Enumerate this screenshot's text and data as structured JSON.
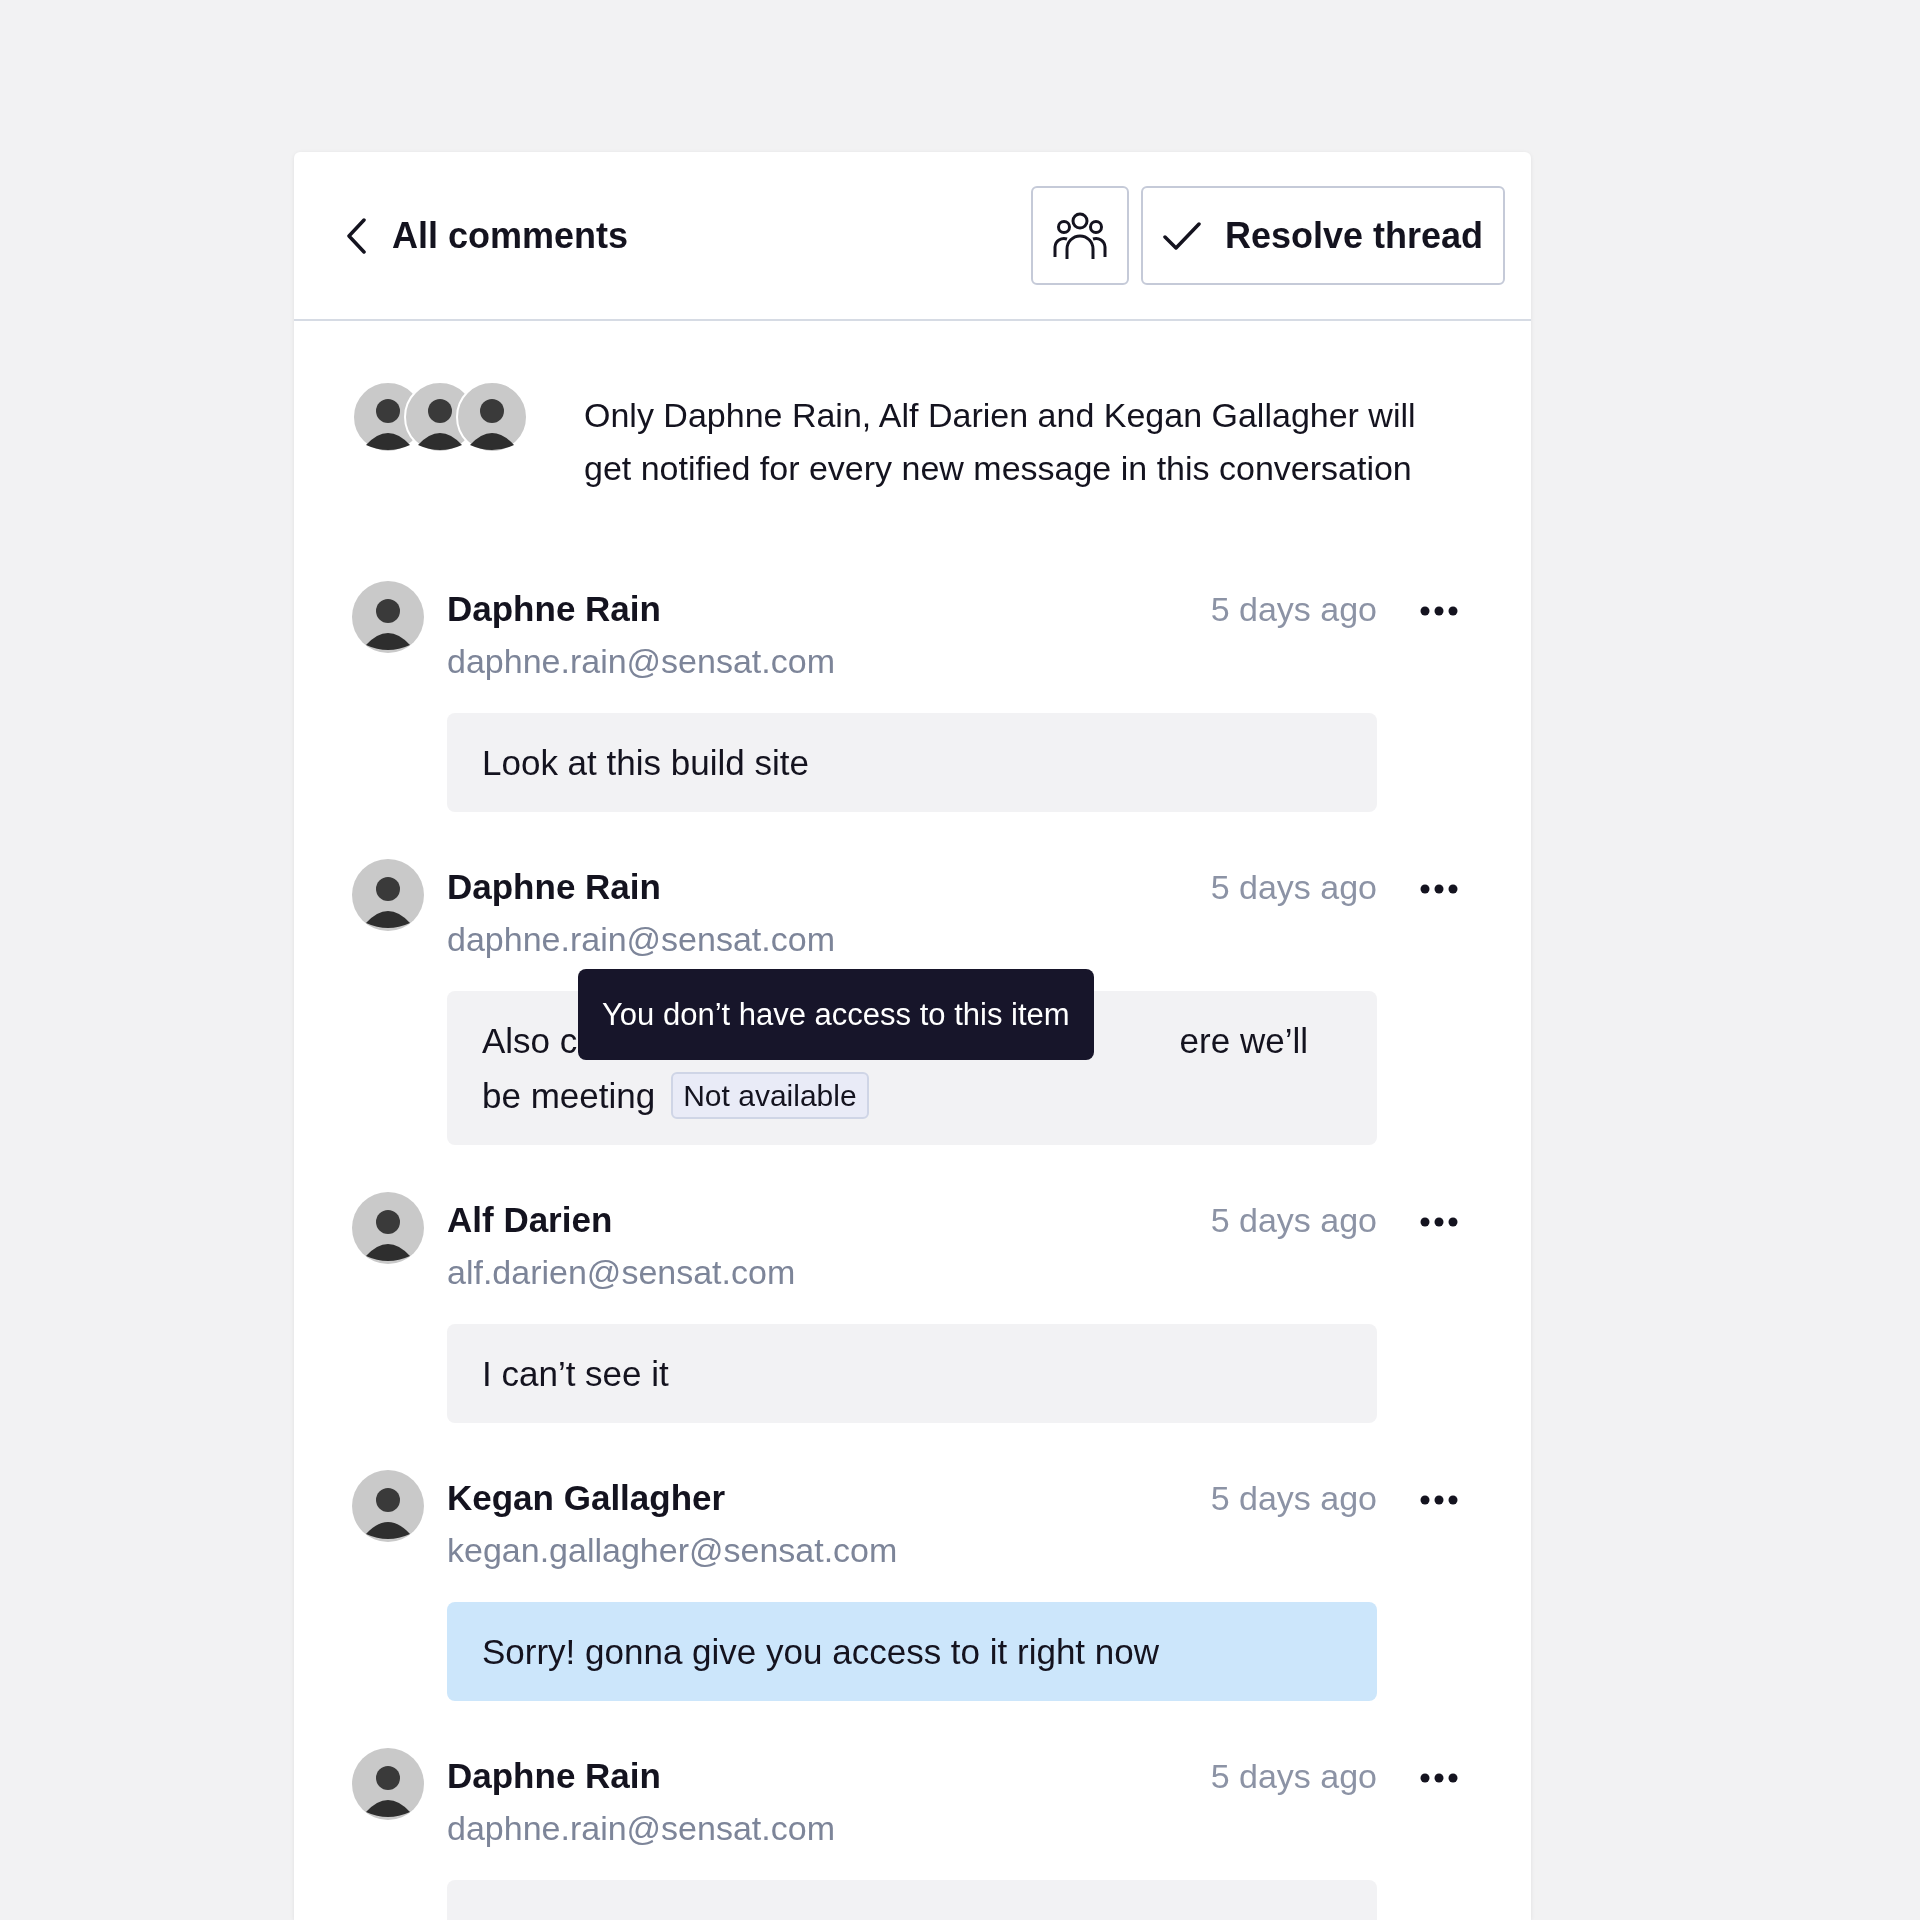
{
  "header": {
    "back_label": "All comments",
    "resolve_label": "Resolve thread"
  },
  "notice": {
    "text": "Only Daphne Rain, Alf Darien and Kegan Gallagher will get notified for every new message in this conversation"
  },
  "messages": [
    {
      "author": "Daphne Rain",
      "email": "daphne.rain@sensat.com",
      "time": "5 days ago",
      "highlighted": false,
      "body": [
        [
          {
            "kind": "text",
            "text": "Look at this build site"
          }
        ]
      ]
    },
    {
      "author": "Daphne Rain",
      "email": "daphne.rain@sensat.com",
      "time": "5 days ago",
      "highlighted": false,
      "tooltip": "You don’t have access to this item",
      "body": [
        [
          {
            "kind": "text",
            "text": "Also c"
          },
          {
            "kind": "hidden"
          },
          {
            "kind": "text",
            "text": "ere we’ll"
          }
        ],
        [
          {
            "kind": "text",
            "text": "be meeting"
          },
          {
            "kind": "chip",
            "text": "Not available"
          }
        ]
      ]
    },
    {
      "author": "Alf Darien",
      "email": "alf.darien@sensat.com",
      "time": "5 days ago",
      "highlighted": false,
      "body": [
        [
          {
            "kind": "text",
            "text": "I can’t see it"
          }
        ]
      ]
    },
    {
      "author": "Kegan Gallagher",
      "email": "kegan.gallagher@sensat.com",
      "time": "5 days ago",
      "highlighted": true,
      "body": [
        [
          {
            "kind": "text",
            "text": "Sorry! gonna give you access to it right now"
          }
        ]
      ]
    },
    {
      "author": "Daphne Rain",
      "email": "daphne.rain@sensat.com",
      "time": "5 days ago",
      "highlighted": false
    }
  ]
}
